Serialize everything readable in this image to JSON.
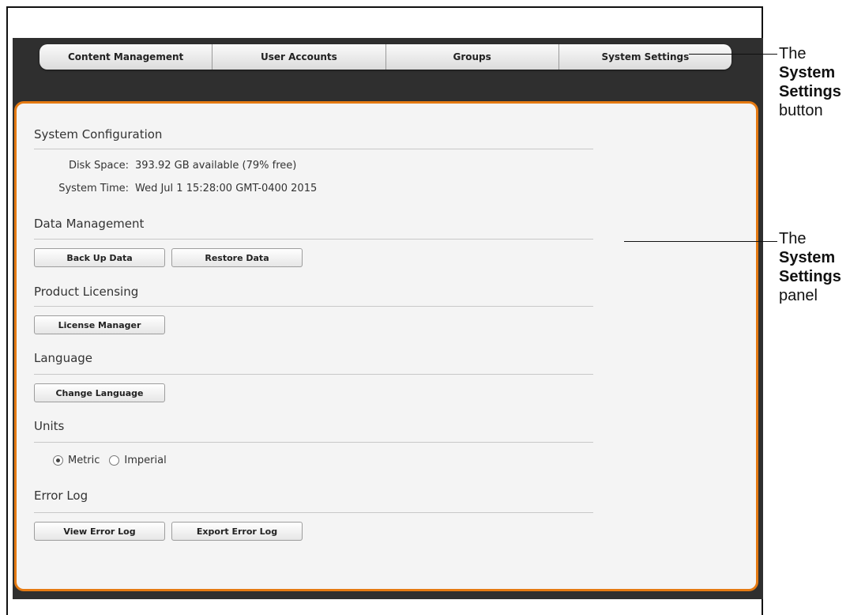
{
  "tabs": [
    {
      "label": "Content Management"
    },
    {
      "label": "User Accounts"
    },
    {
      "label": "Groups"
    },
    {
      "label": "System Settings"
    }
  ],
  "panel": {
    "system_configuration": {
      "title": "System Configuration",
      "disk_space_label": "Disk Space:",
      "disk_space_value": "393.92 GB available (79% free)",
      "system_time_label": "System Time:",
      "system_time_value": "Wed Jul 1 15:28:00 GMT-0400 2015"
    },
    "data_management": {
      "title": "Data Management",
      "back_up_label": "Back Up Data",
      "restore_label": "Restore Data"
    },
    "product_licensing": {
      "title": "Product Licensing",
      "license_manager_label": "License Manager"
    },
    "language": {
      "title": "Language",
      "change_language_label": "Change Language"
    },
    "units": {
      "title": "Units",
      "options": [
        "Metric",
        "Imperial"
      ],
      "selected": "Metric"
    },
    "error_log": {
      "title": "Error Log",
      "view_label": "View Error Log",
      "export_label": "Export Error Log"
    }
  },
  "annotations": {
    "button_callout": {
      "line1": "The",
      "bold1": "System",
      "bold2": "Settings",
      "line4": "button"
    },
    "panel_callout": {
      "line1": "The",
      "bold1": "System",
      "bold2": "Settings",
      "line4": "panel"
    }
  },
  "colors": {
    "accent_border": "#e57a12",
    "app_background": "#2f2f2f",
    "panel_background": "#f4f4f4"
  }
}
